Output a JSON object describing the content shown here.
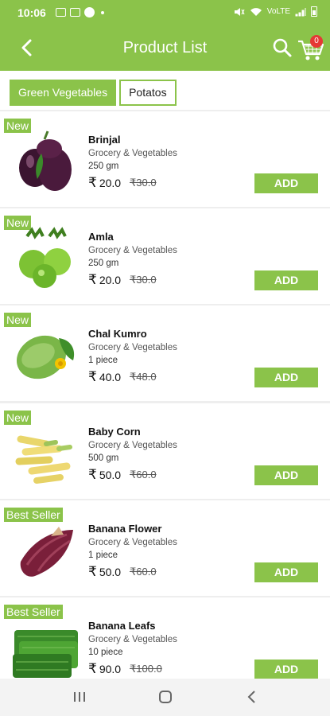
{
  "status_bar": {
    "time": "10:06",
    "network": "VoLTE"
  },
  "app_bar": {
    "title": "Product List",
    "cart_count": "0"
  },
  "tabs": [
    {
      "label": "Green Vegetables",
      "active": true
    },
    {
      "label": "Potatos",
      "active": false
    }
  ],
  "products": [
    {
      "tag": "New",
      "name": "Brinjal",
      "category": "Grocery & Vegetables",
      "quantity": "250 gm",
      "rupee": "₹",
      "price": "20.0",
      "mrp": "₹30.0",
      "add_label": "ADD",
      "image": "brinjal"
    },
    {
      "tag": "New",
      "name": "Amla",
      "category": "Grocery & Vegetables",
      "quantity": "250 gm",
      "rupee": "₹",
      "price": "20.0",
      "mrp": "₹30.0",
      "add_label": "ADD",
      "image": "amla"
    },
    {
      "tag": "New",
      "name": "Chal Kumro",
      "category": "Grocery & Vegetables",
      "quantity": "1 piece",
      "rupee": "₹",
      "price": "40.0",
      "mrp": "₹48.0",
      "add_label": "ADD",
      "image": "ash-gourd"
    },
    {
      "tag": "New",
      "name": "Baby Corn",
      "category": "Grocery & Vegetables",
      "quantity": "500 gm",
      "rupee": "₹",
      "price": "50.0",
      "mrp": "₹60.0",
      "add_label": "ADD",
      "image": "baby-corn"
    },
    {
      "tag": "Best Seller",
      "name": "Banana Flower",
      "category": "Grocery & Vegetables",
      "quantity": "1 piece",
      "rupee": "₹",
      "price": "50.0",
      "mrp": "₹60.0",
      "add_label": "ADD",
      "image": "banana-flower"
    },
    {
      "tag": "Best Seller",
      "name": "Banana Leafs",
      "category": "Grocery & Vegetables",
      "quantity": "10 piece",
      "rupee": "₹",
      "price": "90.0",
      "mrp": "₹100.0",
      "add_label": "ADD",
      "image": "banana-leaf"
    }
  ],
  "colors": {
    "accent": "#8bc34a",
    "badge": "#e53935"
  }
}
